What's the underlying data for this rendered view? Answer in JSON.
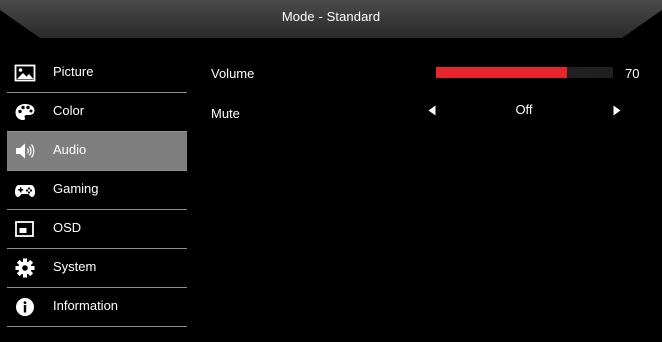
{
  "header": {
    "title": "Mode - Standard"
  },
  "sidebar": {
    "items": [
      {
        "label": "Picture",
        "icon": "picture-icon",
        "active": false
      },
      {
        "label": "Color",
        "icon": "color-palette-icon",
        "active": false
      },
      {
        "label": "Audio",
        "icon": "speaker-icon",
        "active": true
      },
      {
        "label": "Gaming",
        "icon": "gamepad-icon",
        "active": false
      },
      {
        "label": "OSD",
        "icon": "osd-window-icon",
        "active": false
      },
      {
        "label": "System",
        "icon": "gear-icon",
        "active": false
      },
      {
        "label": "Information",
        "icon": "info-icon",
        "active": false
      }
    ]
  },
  "audio": {
    "volume": {
      "label": "Volume",
      "value": "70",
      "fill_fraction": 0.74
    },
    "mute": {
      "label": "Mute",
      "value": "Off"
    }
  },
  "colors": {
    "background": "#000000",
    "active_item": "#7f7f7f",
    "volume_fill": "#e8252a",
    "track": "#202020",
    "text": "#ffffff",
    "header": "#3a3a3a"
  }
}
